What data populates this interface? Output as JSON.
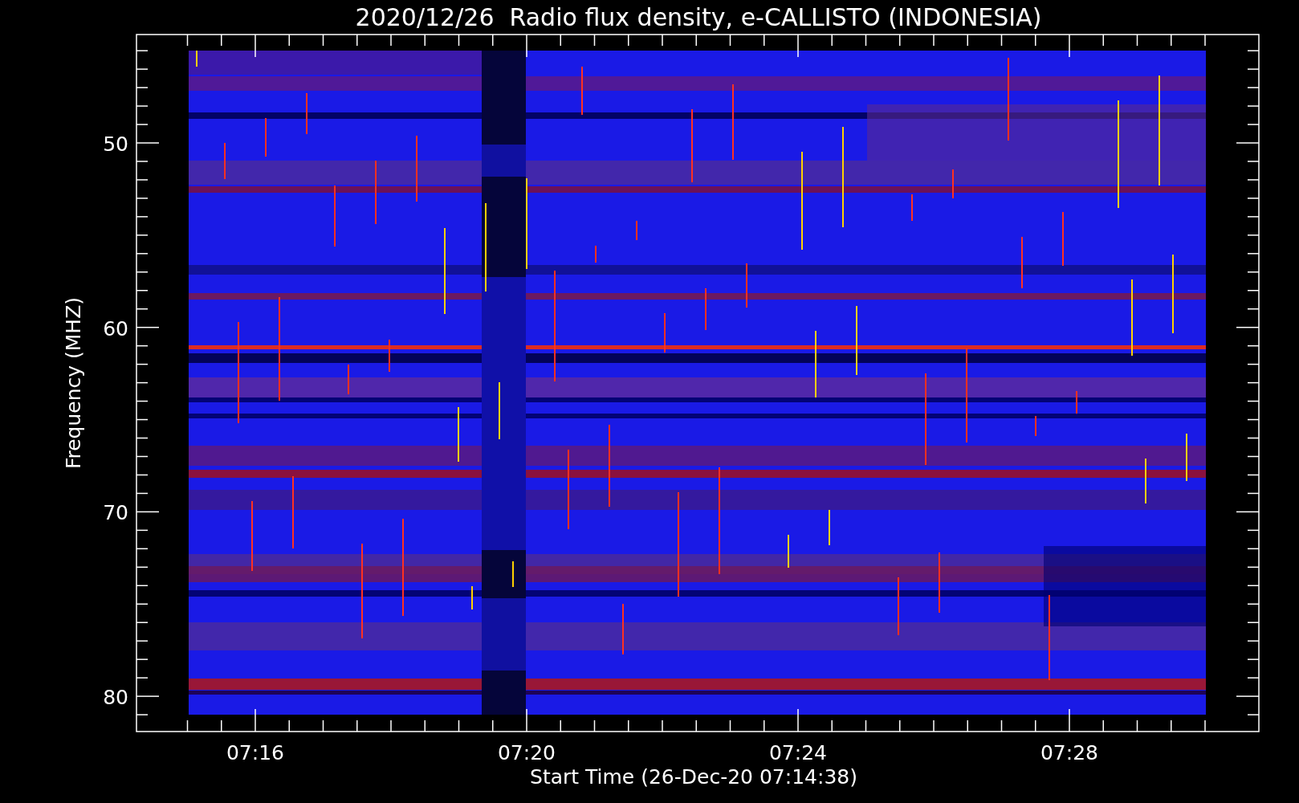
{
  "title": "2020/12/26  Radio flux density, e-CALLISTO (INDONESIA)",
  "y_axis": {
    "label": "Frequency (MHZ)",
    "ticks": [
      "50",
      "60",
      "70",
      "80"
    ]
  },
  "x_axis": {
    "label": "Start Time (26-Dec-20 07:14:38)",
    "ticks": [
      "07:16",
      "07:20",
      "07:24",
      "07:28"
    ]
  }
}
